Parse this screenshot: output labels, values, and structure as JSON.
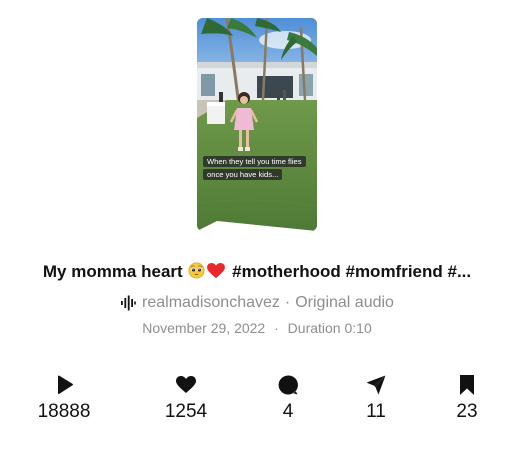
{
  "video": {
    "caption_line1": "When they tell you time flies",
    "caption_line2": "once you have kids..."
  },
  "post": {
    "title_prefix": "My momma heart",
    "emoji_1": "pleading-face-emoji",
    "emoji_2": "red-heart-emoji",
    "title_suffix": "#motherhood #momfriend #..."
  },
  "author": {
    "username": "realmadisonchavez",
    "separator": "·",
    "audio_label": "Original audio"
  },
  "meta": {
    "date": "November 29, 2022",
    "separator": "·",
    "duration": "Duration 0:10"
  },
  "stats": [
    {
      "icon": "play-icon",
      "count": "18888"
    },
    {
      "icon": "heart-icon",
      "count": "1254"
    },
    {
      "icon": "comment-icon",
      "count": "4"
    },
    {
      "icon": "share-icon",
      "count": "11"
    },
    {
      "icon": "bookmark-icon",
      "count": "23"
    }
  ]
}
